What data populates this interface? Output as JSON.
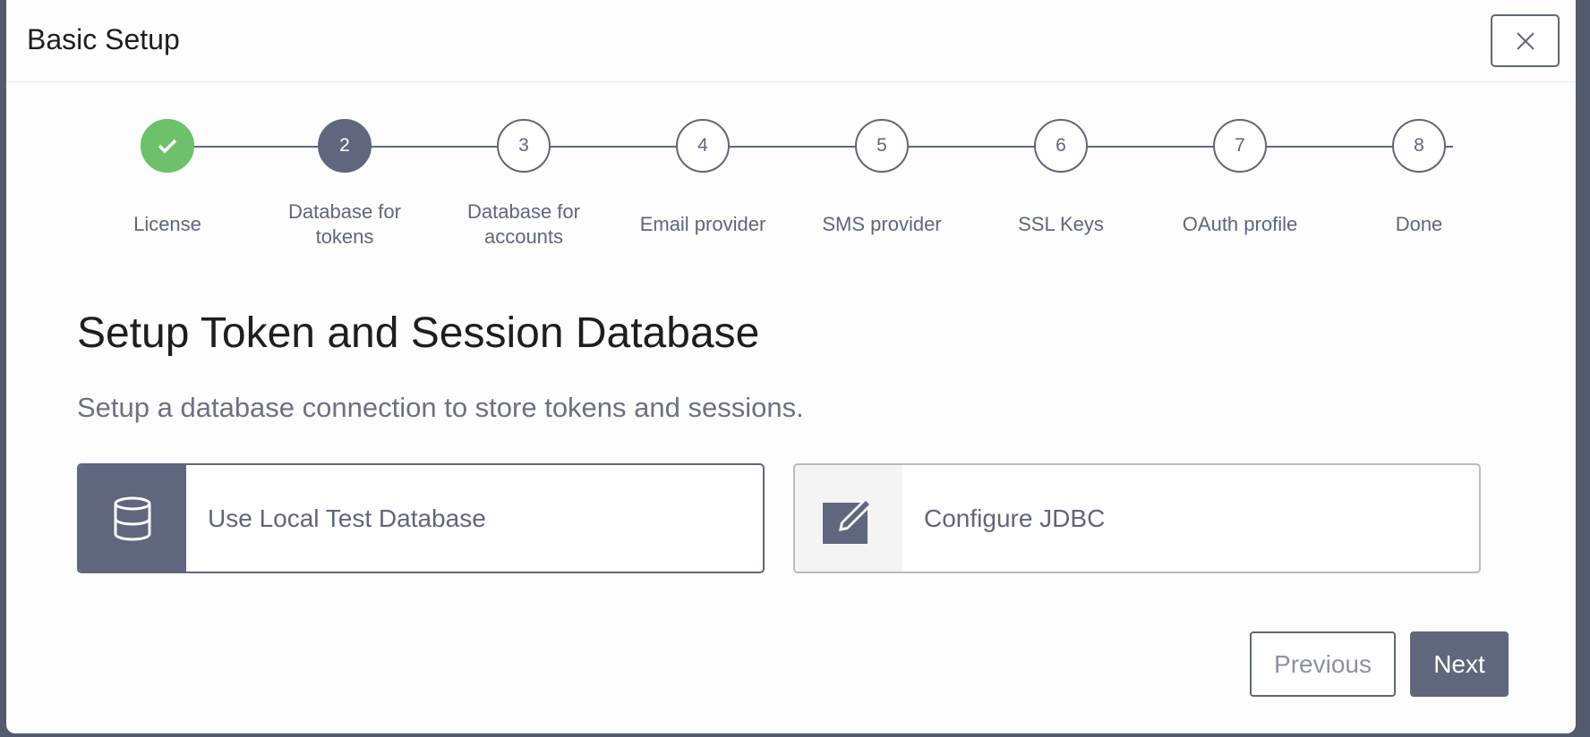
{
  "modal": {
    "title": "Basic Setup",
    "close_icon": "close-icon"
  },
  "stepper": {
    "steps": [
      {
        "number": "1",
        "label": "License",
        "state": "done",
        "icon": "check-icon"
      },
      {
        "number": "2",
        "label": "Database for tokens",
        "state": "current"
      },
      {
        "number": "3",
        "label": "Database for accounts",
        "state": "pending"
      },
      {
        "number": "4",
        "label": "Email provider",
        "state": "pending"
      },
      {
        "number": "5",
        "label": "SMS provider",
        "state": "pending"
      },
      {
        "number": "6",
        "label": "SSL Keys",
        "state": "pending"
      },
      {
        "number": "7",
        "label": "OAuth profile",
        "state": "pending"
      },
      {
        "number": "8",
        "label": "Done",
        "state": "pending"
      }
    ]
  },
  "content": {
    "heading": "Setup Token and Session Database",
    "description": "Setup a database connection to store tokens and sessions.",
    "options": [
      {
        "label": "Use Local Test Database",
        "icon": "database-icon",
        "selected": true
      },
      {
        "label": "Configure JDBC",
        "icon": "edit-icon",
        "selected": false
      }
    ]
  },
  "footer": {
    "previous_label": "Previous",
    "next_label": "Next"
  },
  "colors": {
    "accent": "#5f667e",
    "success": "#6cc16a"
  }
}
